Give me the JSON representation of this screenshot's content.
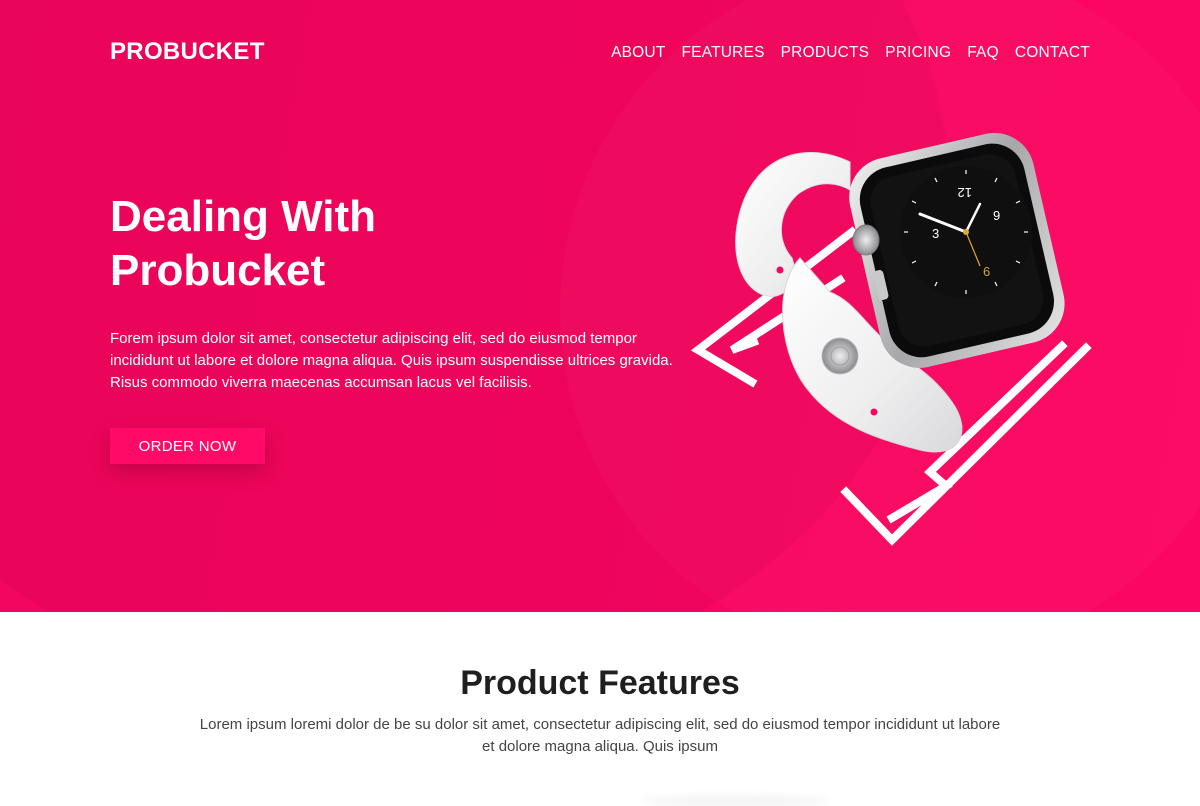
{
  "brand": {
    "name": "PROBUCKET",
    "accent": "#f7065f",
    "button_color": "#ff0a66"
  },
  "nav": {
    "items": [
      {
        "label": "ABOUT",
        "name": "nav-about"
      },
      {
        "label": "FEATURES",
        "name": "nav-features"
      },
      {
        "label": "PRODUCTS",
        "name": "nav-products"
      },
      {
        "label": "PRICING",
        "name": "nav-pricing"
      },
      {
        "label": "FAQ",
        "name": "nav-faq"
      },
      {
        "label": "CONTACT",
        "name": "nav-contact"
      }
    ]
  },
  "hero": {
    "title_line1": "Dealing With",
    "title_line2": "Probucket",
    "text": "Forem ipsum dolor sit amet, consectetur adipiscing elit, sed do eiusmod tempor incididunt ut labore et dolore magna aliqua. Quis ipsum suspendisse ultrices gravida. Risus commodo viverra maecenas accumsan lacus vel facilisis.",
    "cta_label": "ORDER NOW",
    "image": "smartwatch-image"
  },
  "features": {
    "title": "Product Features",
    "text": "Lorem ipsum loremi dolor de be su dolor sit amet, consectetur adipiscing elit, sed do eiusmod tempor incididunt ut labore et dolore magna aliqua. Quis ipsum"
  },
  "watch_face": {
    "numerals": [
      "12",
      "3",
      "6",
      "9"
    ]
  }
}
